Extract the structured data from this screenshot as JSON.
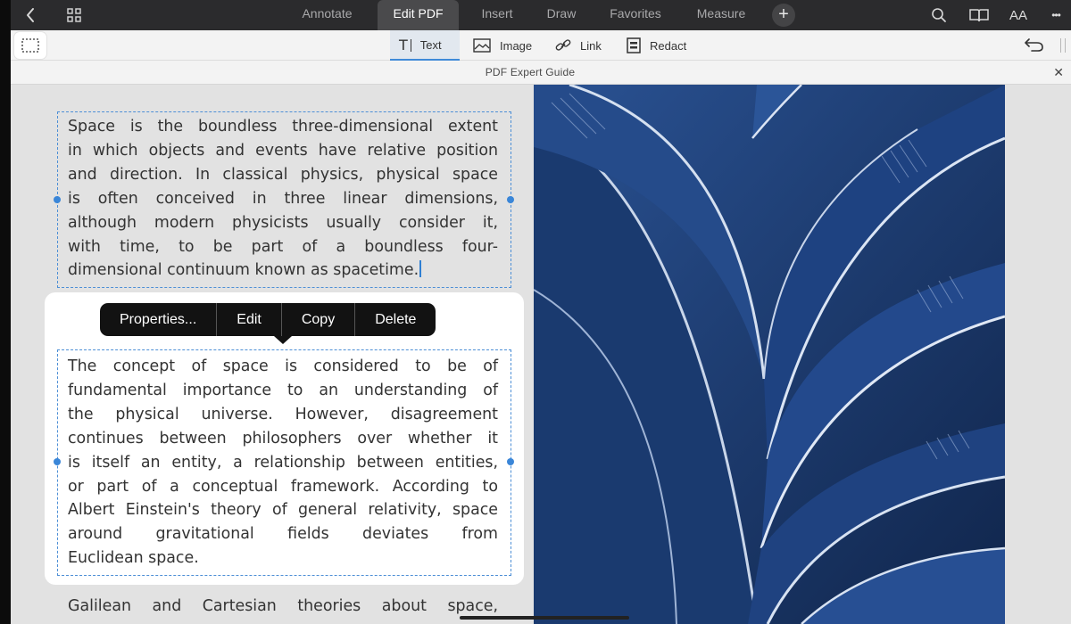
{
  "top_tabs": {
    "items": [
      {
        "label": "Annotate"
      },
      {
        "label": "Edit PDF"
      },
      {
        "label": "Insert"
      },
      {
        "label": "Draw"
      },
      {
        "label": "Favorites"
      },
      {
        "label": "Measure"
      }
    ],
    "active": "Edit PDF",
    "add_label": "+",
    "font_label": "AA",
    "more_label": "•••"
  },
  "tools": {
    "text_label": "Text",
    "image_label": "Image",
    "link_label": "Link",
    "redact_label": "Redact",
    "active": "Text"
  },
  "document": {
    "title": "PDF Expert Guide",
    "close_label": "✕"
  },
  "paragraphs": {
    "p1": [
      "Space is the boundless three-dimensional extent",
      "in which objects and events have relative position",
      "and direction. In classical physics, physical space",
      "is often conceived in three linear dimensions,",
      "although modern physicists usually consider it,",
      "with time, to be part of a boundless four-",
      "dimensional continuum known as spacetime."
    ],
    "p2": [
      "The concept of space is considered to be of",
      "fundamental importance to an understanding of",
      "the physical universe. However, disagreement",
      "continues between philosophers over whether it",
      "is itself an entity, a relationship between entities,",
      "or part of a conceptual framework. According to",
      "Albert Einstein's theory of general relativity, space",
      "around gravitational fields deviates from",
      "Euclidean space."
    ],
    "p3": [
      "Galilean and Cartesian theories about space,"
    ]
  },
  "context_menu": {
    "properties": "Properties...",
    "edit": "Edit",
    "copy": "Copy",
    "delete": "Delete"
  },
  "colors": {
    "accent": "#3a86d8",
    "image_blue": "#1b3968"
  }
}
